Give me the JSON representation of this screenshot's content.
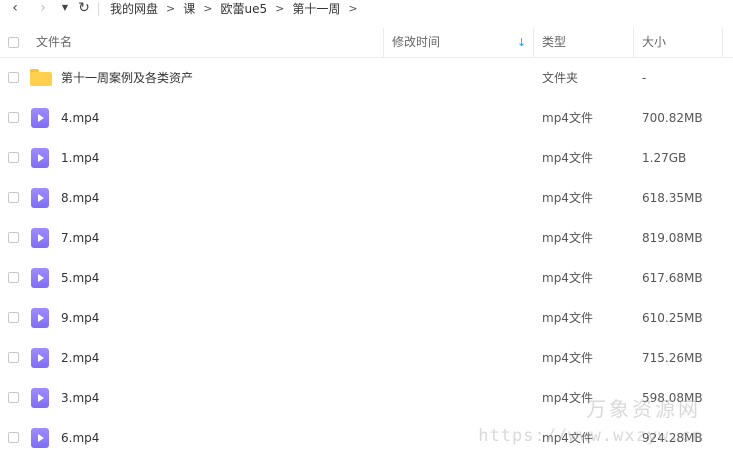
{
  "nav": {
    "back_icon": "‹",
    "forward_icon": "›",
    "dropdown_icon": "▼",
    "refresh_icon": "↻",
    "breadcrumbs": [
      "我的网盘",
      "课",
      "欧蕾ue5",
      "第十一周"
    ],
    "separator": ">"
  },
  "columns": {
    "name": "文件名",
    "modified": "修改时间",
    "type": "类型",
    "size": "大小",
    "sort_indicator": "↓",
    "sort_color": "#1f9eff"
  },
  "files": [
    {
      "name": "第十一周案例及各类资产",
      "type": "文件夹",
      "size": "-",
      "icon": "folder-icon"
    },
    {
      "name": "4.mp4",
      "type": "mp4文件",
      "size": "700.82MB",
      "icon": "video-file-icon"
    },
    {
      "name": "1.mp4",
      "type": "mp4文件",
      "size": "1.27GB",
      "icon": "video-file-icon"
    },
    {
      "name": "8.mp4",
      "type": "mp4文件",
      "size": "618.35MB",
      "icon": "video-file-icon"
    },
    {
      "name": "7.mp4",
      "type": "mp4文件",
      "size": "819.08MB",
      "icon": "video-file-icon"
    },
    {
      "name": "5.mp4",
      "type": "mp4文件",
      "size": "617.68MB",
      "icon": "video-file-icon"
    },
    {
      "name": "9.mp4",
      "type": "mp4文件",
      "size": "610.25MB",
      "icon": "video-file-icon"
    },
    {
      "name": "2.mp4",
      "type": "mp4文件",
      "size": "715.26MB",
      "icon": "video-file-icon"
    },
    {
      "name": "3.mp4",
      "type": "mp4文件",
      "size": "598.08MB",
      "icon": "video-file-icon"
    },
    {
      "name": "6.mp4",
      "type": "mp4文件",
      "size": "924.28MB",
      "icon": "video-file-icon"
    }
  ],
  "watermark": {
    "title": "万象资源网",
    "url": "https://www.wxzyw.cn"
  }
}
